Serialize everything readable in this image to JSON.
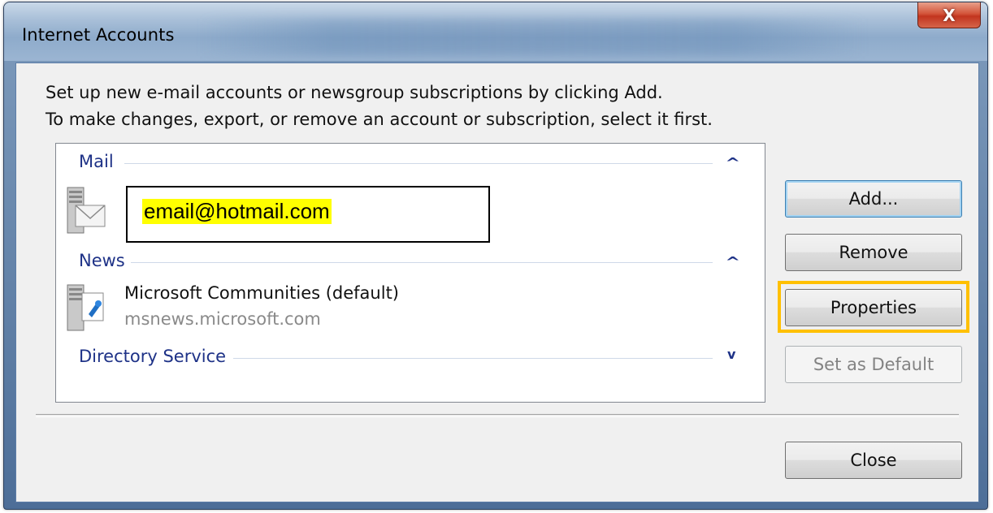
{
  "window": {
    "title": "Internet Accounts",
    "close_glyph": "X"
  },
  "intro": {
    "line1": "Set up new e-mail accounts or newsgroup subscriptions by clicking Add.",
    "line2": "To make changes, export, or remove an account or subscription, select it first."
  },
  "accounts": {
    "groups": [
      {
        "label": "Mail",
        "expanded": true
      },
      {
        "label": "News",
        "expanded": true
      },
      {
        "label": "Directory Service",
        "expanded": false
      }
    ],
    "mail_item": {
      "email": "email@hotmail.com",
      "icon": "mail-account-icon"
    },
    "news_item": {
      "name": "Microsoft Communities (default)",
      "server": "msnews.microsoft.com",
      "icon": "news-account-icon"
    }
  },
  "buttons": {
    "add": "Add...",
    "remove": "Remove",
    "properties": "Properties",
    "set_default": "Set as Default",
    "close": "Close"
  },
  "icons": {
    "collapse": "chevron-up-icon",
    "expand": "chevron-down-icon",
    "chevron_up_glyph": "^",
    "chevron_down_glyph": "v"
  },
  "colors": {
    "highlight": "#ffc000",
    "group_header": "#1e3287",
    "email_highlight": "#ffff00"
  }
}
